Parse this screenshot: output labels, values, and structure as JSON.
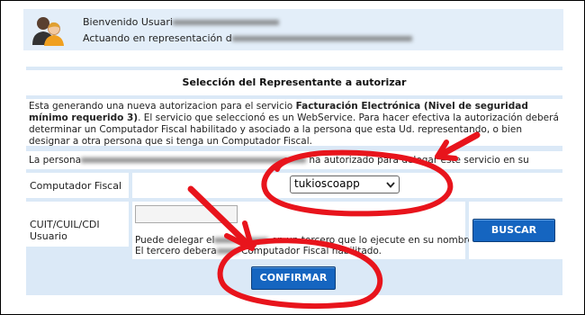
{
  "header": {
    "line1": "Bienvenido Usuari",
    "line2": "Actuando en representación d"
  },
  "panel": {
    "title": "Selección del Representante a autorizar",
    "description_pre": "Esta generando una nueva autorizacion para el servicio ",
    "service_name": "Facturación Electrónica (Nivel de seguridad mínimo requerido 3)",
    "description_post": ". El servicio que seleccionó es un WebService. Para hacer efectiva la autorización deberá determinar un Computador Fiscal habilitado y asociado a la persona que esta Ud. representando, o bien designar a otra persona que si tenga un Computador Fiscal.",
    "persona_pre": "La persona",
    "persona_mid": "ha autorizado para delegar este servicio en su nombre.",
    "computador_label": "Computador Fiscal",
    "computador_value": "tukioscoapp",
    "cuit_label": "CUIT/CUIL/CDI Usuario",
    "hint_line1": "Puede delegar el",
    "hint_line1b": "en un tercero que lo ejecute en su nombre.",
    "hint_line2": "El tercero debera",
    "hint_line2b": "Computador Fiscal habilitado.",
    "buscar_label": "BUSCAR",
    "confirmar_label": "CONFIRMAR"
  },
  "colors": {
    "header_bg": "#e3eef9",
    "panel_bg": "#dbe9f7",
    "button": "#1565c0",
    "annotation": "#e8141c"
  },
  "icons": [
    "users-icon",
    "chevron-down-icon"
  ]
}
